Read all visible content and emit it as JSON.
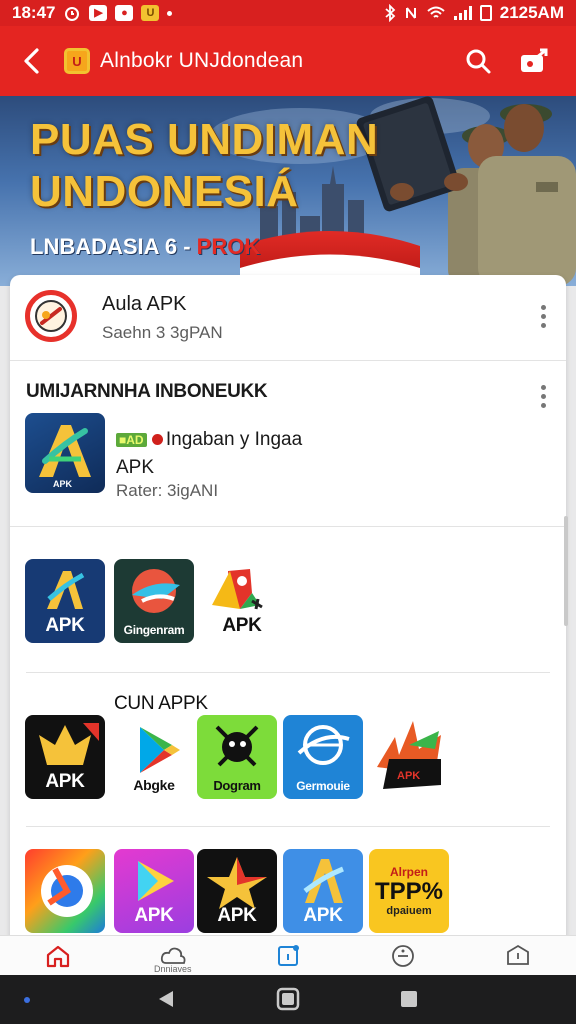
{
  "status_bar": {
    "time": "18:47",
    "right_text": "2125AM",
    "icons": [
      "alarm-icon",
      "app-notification-icon",
      "app-notification-icon",
      "sim-icon",
      "dot-icon",
      "bluetooth-icon",
      "mute-icon",
      "wifi-icon",
      "signal-icon",
      "battery-icon"
    ]
  },
  "app_bar": {
    "logo_letter": "U",
    "title": "Alnbokr UNJdondean",
    "actions": [
      "search-icon",
      "share-icon"
    ]
  },
  "banner": {
    "title_line1": "PUAS UNDIMAN",
    "title_line2": "UNDONESIÁ",
    "subtitle_main": "LNBADASIA 6 -",
    "subtitle_accent": "PROK"
  },
  "app_row": {
    "name": "Aula APK",
    "subtitle": "Saehn 3 3gPAN"
  },
  "featured": {
    "heading": "UMIJARNNHA INBONEUKK",
    "tag_text": "Ingaban y Ingaa",
    "tag_pill": "■AD",
    "type": "APK",
    "rating": "Rater: 3igANI",
    "icon_caption": "APK"
  },
  "row1": [
    {
      "label": "APK",
      "icon": "apk-letter-a-icon",
      "bg": "#173a74"
    },
    {
      "label": "Gingenram",
      "icon": "bird-icon",
      "bg": "#1d3a34"
    },
    {
      "label": "APK",
      "icon": "apk-maps-icon",
      "bg": "#ffffff"
    }
  ],
  "section2_heading": "CUN APPK",
  "row2": [
    {
      "label": "APK",
      "icon": "crown-star-icon",
      "bg": "#111111"
    },
    {
      "label": "Abgke",
      "icon": "play-store-icon",
      "bg": "#ffffff"
    },
    {
      "label": "Dogram",
      "icon": "bug-robot-icon",
      "bg": "#7ddc3a"
    },
    {
      "label": "Germouie",
      "icon": "globe-swoosh-icon",
      "bg": "#1f84d6"
    },
    {
      "label": "APK",
      "icon": "flame-apk-icon",
      "bg": "#ffffff"
    }
  ],
  "row3": [
    {
      "label": "",
      "icon": "circle-logo-icon",
      "bg": "#ff6a2a"
    },
    {
      "label": "APK",
      "icon": "play-triangle-icon",
      "bg": "#c63fd6"
    },
    {
      "label": "APK",
      "icon": "star-apk-icon",
      "bg": "#111111"
    },
    {
      "label": "APK",
      "icon": "letter-a-apk-icon",
      "bg": "#3f8fe6"
    },
    {
      "label": "TPP%",
      "sublabel": "dpaiuem",
      "top": "Alrpen",
      "icon": "yellow-badge-icon",
      "bg": "#f9c620"
    }
  ],
  "bottom_nav": [
    {
      "icon": "home-icon",
      "label": ""
    },
    {
      "icon": "cloud-icon",
      "label": "Dnniaves"
    },
    {
      "icon": "tablet-icon",
      "label": ""
    },
    {
      "icon": "timer-icon",
      "label": ""
    },
    {
      "icon": "box-icon",
      "label": ""
    }
  ],
  "colors": {
    "brand_red": "#e42521",
    "banner_gold": "#f5c23a"
  }
}
